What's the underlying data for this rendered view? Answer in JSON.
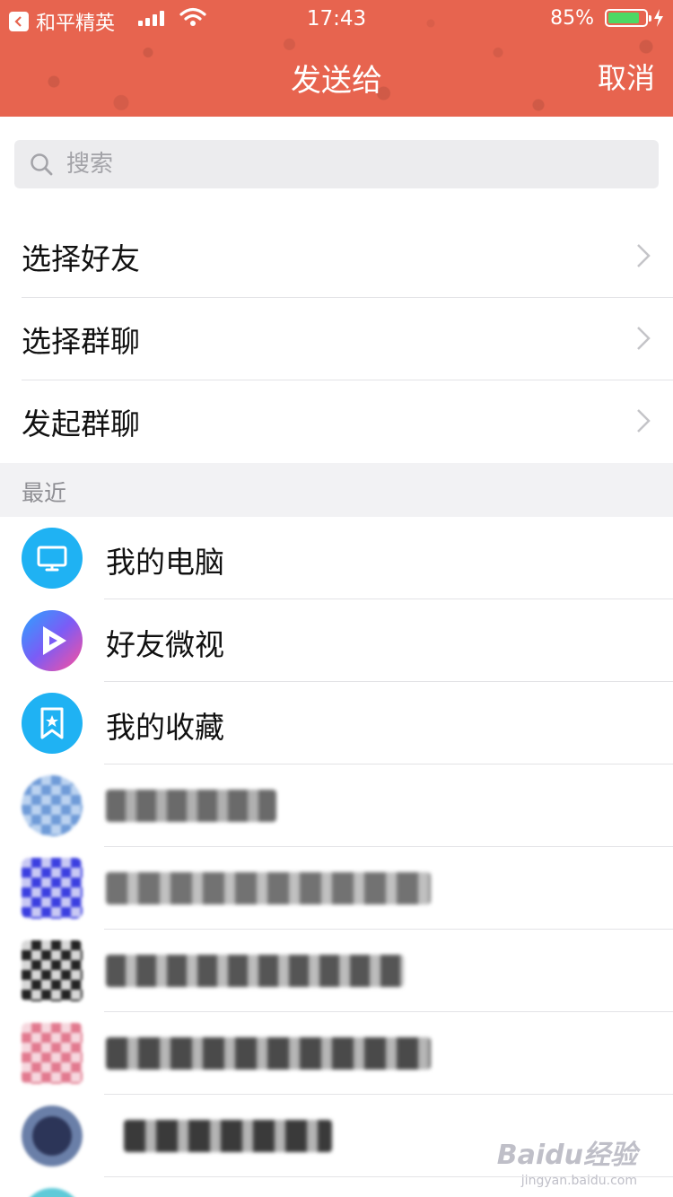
{
  "status_bar": {
    "back_app": "和平精英",
    "time": "17:43",
    "battery": "85%",
    "battery_level": 0.85
  },
  "nav": {
    "title": "发送给",
    "cancel": "取消"
  },
  "search": {
    "placeholder": "搜索"
  },
  "menu": [
    {
      "label": "选择好友"
    },
    {
      "label": "选择群聊"
    },
    {
      "label": "发起群聊"
    }
  ],
  "section_title": "最近",
  "recent": [
    {
      "name": "我的电脑",
      "icon": "computer-icon",
      "color": "#1fb2f3"
    },
    {
      "name": "好友微视",
      "icon": "weishi-play-icon",
      "color": "#7b5cf6"
    },
    {
      "name": "我的收藏",
      "icon": "bookmark-star-icon",
      "color": "#1fb2f3"
    }
  ],
  "watermark": {
    "text": "Baidu经验",
    "url": "jingyan.baidu.com"
  },
  "colors": {
    "header": "#e7644f",
    "accent_blue": "#1fb2f3",
    "divider": "#e3e3e6"
  }
}
